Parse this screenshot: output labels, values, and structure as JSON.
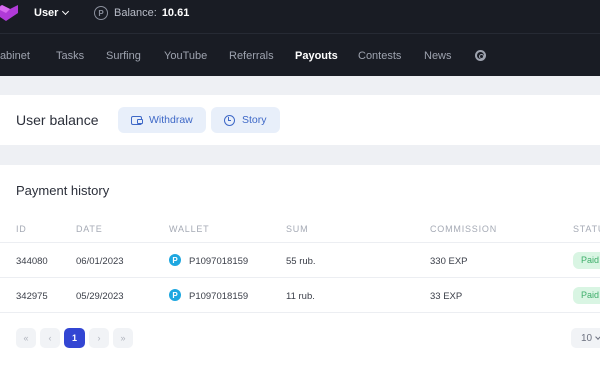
{
  "header": {
    "user_label": "User",
    "balance_label": "Balance:",
    "balance_value": "10.61",
    "coin_glyph": "P"
  },
  "nav": {
    "items": [
      "Cabinet",
      "Tasks",
      "Surfing",
      "YouTube",
      "Referrals",
      "Payouts",
      "Contests",
      "News"
    ],
    "active": "Payouts",
    "settings_icon": "gear-icon"
  },
  "balance_card": {
    "title": "User balance",
    "withdraw_label": "Withdraw",
    "story_label": "Story"
  },
  "history": {
    "title": "Payment history",
    "columns": [
      "ID",
      "DATE",
      "WALLET",
      "SUM",
      "COMMISSION",
      "STATUS"
    ],
    "rows": [
      {
        "id": "344080",
        "date": "06/01/2023",
        "wallet_glyph": "P",
        "wallet": "P1097018159",
        "sum": "55 rub.",
        "commission": "330 EXP",
        "status": "Paid"
      },
      {
        "id": "342975",
        "date": "05/29/2023",
        "wallet_glyph": "P",
        "wallet": "P1097018159",
        "sum": "11 rub.",
        "commission": "33 EXP",
        "status": "Paid"
      }
    ]
  },
  "pagination": {
    "first": "«",
    "prev": "‹",
    "current": "1",
    "next": "›",
    "last": "»",
    "per_page": "10"
  },
  "colors": {
    "topbar": "#191c24",
    "accent": "#3346d3",
    "button_bg": "#e8effa",
    "paid_bg": "#d9f5e3",
    "paid_text": "#3fae6b",
    "wallet_badge": "#1ea7e0",
    "logo": "#b03ad8"
  }
}
